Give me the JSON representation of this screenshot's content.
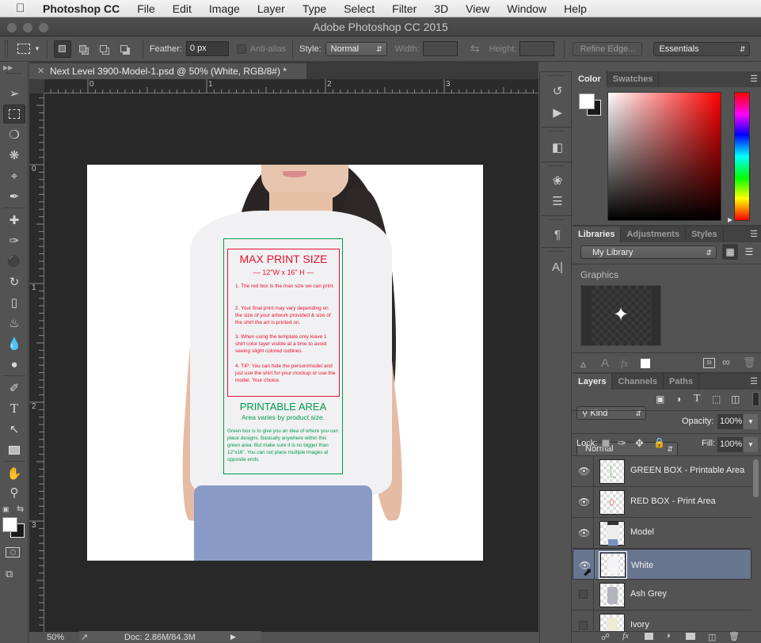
{
  "menubar": {
    "apple": "",
    "app": "Photoshop CC",
    "items": [
      "File",
      "Edit",
      "Image",
      "Layer",
      "Type",
      "Select",
      "Filter",
      "3D",
      "View",
      "Window",
      "Help"
    ]
  },
  "window": {
    "title": "Adobe Photoshop CC 2015"
  },
  "options": {
    "feather_label": "Feather:",
    "feather_value": "0 px",
    "antialias_label": "Anti-alias",
    "style_label": "Style:",
    "style_value": "Normal",
    "width_label": "Width:",
    "height_label": "Height:",
    "refine_edge": "Refine Edge...",
    "workspace": "Essentials"
  },
  "document": {
    "tab_title": "Next Level 3900-Model-1.psd @ 50% (White, RGB/8#) *",
    "ruler_h": [
      "0",
      "1",
      "2",
      "3"
    ],
    "ruler_v": [
      "0",
      "1",
      "2",
      "3"
    ],
    "zoom": "50%",
    "doc_size": "Doc: 2.86M/84.3M"
  },
  "artwork": {
    "red_title": "MAX PRINT SIZE",
    "red_sub": "— 12\"W x 16\" H —",
    "red_p1": "1. The red box is the max size we can print.",
    "red_p2": "2. Your final print may vary depending on the size of your artwork provided & size of the shirt the art is printed on.",
    "red_p3": "3. When using the template only leave 1 shirt color layer visible at a time to avoid seeing slight colored outlines.",
    "red_p4": "4. TIP: You can hide the person/model and just use the shirt for your mockup or use the model. Your choice.",
    "green_title": "PRINTABLE AREA",
    "green_sub": "Area varies by product size.",
    "green_p": "Green box is to give you an idea of where you can place designs. Basically anywhere within this green area.  But make sure it is no bigger than 12\"x16\".  You can not place multiple images at opposite ends.",
    "red_color": "#e8112d",
    "green_color": "#009b4e"
  },
  "color_panel": {
    "tabs": [
      "Color",
      "Swatches"
    ],
    "foreground": "#ffffff",
    "background": "#1a1a1a"
  },
  "libraries_panel": {
    "tabs": [
      "Libraries",
      "Adjustments",
      "Styles"
    ],
    "library": "My Library",
    "section": "Graphics"
  },
  "layers_panel": {
    "tabs": [
      "Layers",
      "Channels",
      "Paths"
    ],
    "filter": "Kind",
    "blend_mode": "Normal",
    "opacity_label": "Opacity:",
    "opacity": "100%",
    "lock_label": "Lock:",
    "fill_label": "Fill:",
    "fill": "100%",
    "layers": [
      {
        "name": "GREEN BOX - Printable Area",
        "visible": true,
        "selected": false
      },
      {
        "name": "RED BOX - Print Area",
        "visible": true,
        "selected": false
      },
      {
        "name": "Model",
        "visible": true,
        "selected": false
      },
      {
        "name": "White",
        "visible": true,
        "selected": true
      },
      {
        "name": "Ash Grey",
        "visible": false,
        "selected": false
      },
      {
        "name": "Ivory",
        "visible": false,
        "selected": false
      }
    ]
  }
}
